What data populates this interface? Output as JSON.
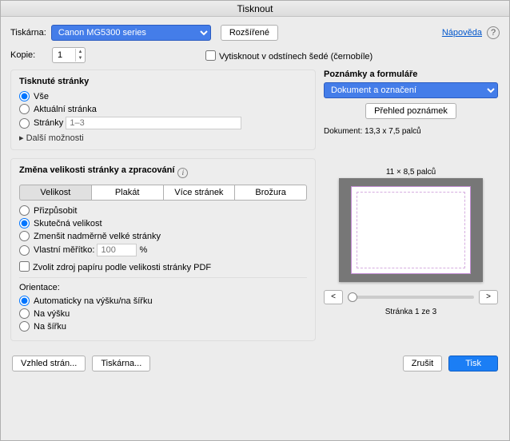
{
  "title": "Tisknout",
  "header": {
    "printer_label": "Tiskárna:",
    "printer_value": "Canon MG5300 series",
    "advanced": "Rozšířené",
    "help": "Nápověda",
    "copies_label": "Kopie:",
    "copies_value": "1",
    "grayscale": "Vytisknout v odstínech šedé (černobíle)"
  },
  "pages_section": {
    "title": "Tisknuté stránky",
    "all": "Vše",
    "current": "Aktuální stránka",
    "range": "Stránky",
    "range_placeholder": "1–3",
    "more": "Další možnosti"
  },
  "size_section": {
    "title": "Změna velikosti stránky a zpracování",
    "tabs": {
      "size": "Velikost",
      "poster": "Plakát",
      "multi": "Více stránek",
      "booklet": "Brožura"
    },
    "fit": "Přizpůsobit",
    "actual": "Skutečná velikost",
    "shrink": "Zmenšit nadměrně velké stránky",
    "scale": "Vlastní měřítko:",
    "scale_value": "100",
    "scale_unit": "%",
    "paper_source": "Zvolit zdroj papíru podle velikosti stránky PDF"
  },
  "orientation": {
    "title": "Orientace:",
    "auto": "Automaticky na výšku/na šířku",
    "portrait": "Na výšku",
    "landscape": "Na šířku"
  },
  "right": {
    "comments_title": "Poznámky a formuláře",
    "comments_sel": "Dokument a označení",
    "summary": "Přehled poznámek",
    "doc_size": "Dokument: 13,3 x 7,5 palců",
    "preview_size": "11 × 8,5 palců",
    "prev": "<",
    "next": ">",
    "page_ind": "Stránka 1 ze 3"
  },
  "footer": {
    "page_setup": "Vzhled strán...",
    "printer": "Tiskárna...",
    "cancel": "Zrušit",
    "print": "Tisk"
  }
}
